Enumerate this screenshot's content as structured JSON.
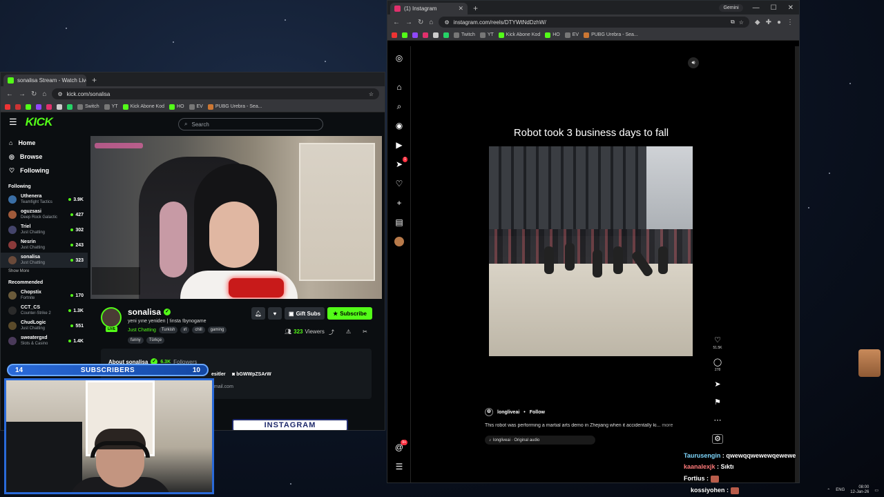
{
  "kick_browser": {
    "tab_title": "sonalisa Stream - Watch Live on",
    "url": "kick.com/sonalisa",
    "bookmarks": [
      "Switch",
      "YT",
      "Kick Abone Kod",
      "HO",
      "EV",
      "PUBG Urebra - Sea..."
    ]
  },
  "kick": {
    "logo": "KICK",
    "search_placeholder": "Search",
    "nav": [
      {
        "label": "Home",
        "icon": "home-icon"
      },
      {
        "label": "Browse",
        "icon": "compass-icon"
      },
      {
        "label": "Following",
        "icon": "heart-icon"
      }
    ],
    "following_title": "Following",
    "following": [
      {
        "name": "Uthenera",
        "cat": "Teamfight Tactics",
        "viewers": "3.9K",
        "color": "#3a6ea5"
      },
      {
        "name": "oguzsasi",
        "cat": "Deep Rock Galactic",
        "viewers": "427",
        "color": "#a05a3a"
      },
      {
        "name": "Triel",
        "cat": "Just Chatting",
        "viewers": "302",
        "color": "#44446a"
      },
      {
        "name": "Nesrin",
        "cat": "Just Chatting",
        "viewers": "243",
        "color": "#8a3a3a"
      },
      {
        "name": "sonalisa",
        "cat": "Just Chatting",
        "viewers": "323",
        "color": "#6a4a3a"
      }
    ],
    "show_more": "Show More",
    "recommended_title": "Recommended",
    "recommended": [
      {
        "name": "Chopstix",
        "cat": "Fortnite",
        "viewers": "170",
        "color": "#6a5a3a"
      },
      {
        "name": "CCT_CS",
        "cat": "Counter-Strike 2",
        "viewers": "1.3K",
        "color": "#2a2a2a"
      },
      {
        "name": "ChudLogic",
        "cat": "Just Chatting",
        "viewers": "551",
        "color": "#5a4a2a"
      },
      {
        "name": "sweatergxd",
        "cat": "Slots & Casino",
        "viewers": "1.4K",
        "color": "#4a3a5a"
      }
    ],
    "streamer": {
      "name": "sonalisa",
      "live": "LIVE",
      "title": "yeni yıne yeniden | !insta !bynogame",
      "category": "Just Chatting",
      "pills": [
        "Turkish",
        "ırl",
        "chill",
        "gaming"
      ],
      "tags": [
        "funny",
        "Türkçe"
      ],
      "viewers": "323",
      "viewers_label": "Viewers",
      "gift_label": "Gift Subs",
      "subscribe_label": "Subscribe"
    },
    "about": {
      "title": "About sonalisa",
      "followers": "6.3K",
      "followers_label": "Followers",
      "link_partial": "esitler",
      "link": "bGWWpZSArW",
      "mail_partial": "gmail.com"
    },
    "banner_text": "INSTAGRAM"
  },
  "overlay": {
    "subs_left": "14",
    "subs_label": "SUBSCRIBERS",
    "subs_right": "10"
  },
  "ig_browser": {
    "tab_title": "(1) Instagram",
    "url": "instagram.com/reels/DTYWtNdDzhW/",
    "gemini": "Gemini",
    "bookmarks": [
      "Twitch",
      "YT",
      "Kick Abone Kod",
      "HO",
      "EV",
      "PUBG Urebra - Sea..."
    ]
  },
  "reel": {
    "caption": "Robot took 3 business days to fall",
    "author": "longliveai",
    "follow": "Follow",
    "description": "This robot was performing a martial arts demo in Zhejiang when it accidentally ki...",
    "more": "more",
    "audio": "longliveai · Original audio",
    "likes": "51.5K",
    "comments": "278",
    "rail_badge_1": "1",
    "rail_badge_2": "9+"
  },
  "chat": [
    {
      "user": "Taurusengin",
      "msg": "qwewqqwewewqewewe"
    },
    {
      "user": "kaanalexjk",
      "msg": "Sıktı"
    },
    {
      "user": "Fortius",
      "msg": ""
    },
    {
      "user": "kossiyohen",
      "msg": ""
    }
  ],
  "tray": {
    "lang": "ENG",
    "time": "08:00",
    "date": "12-Jan-26"
  }
}
